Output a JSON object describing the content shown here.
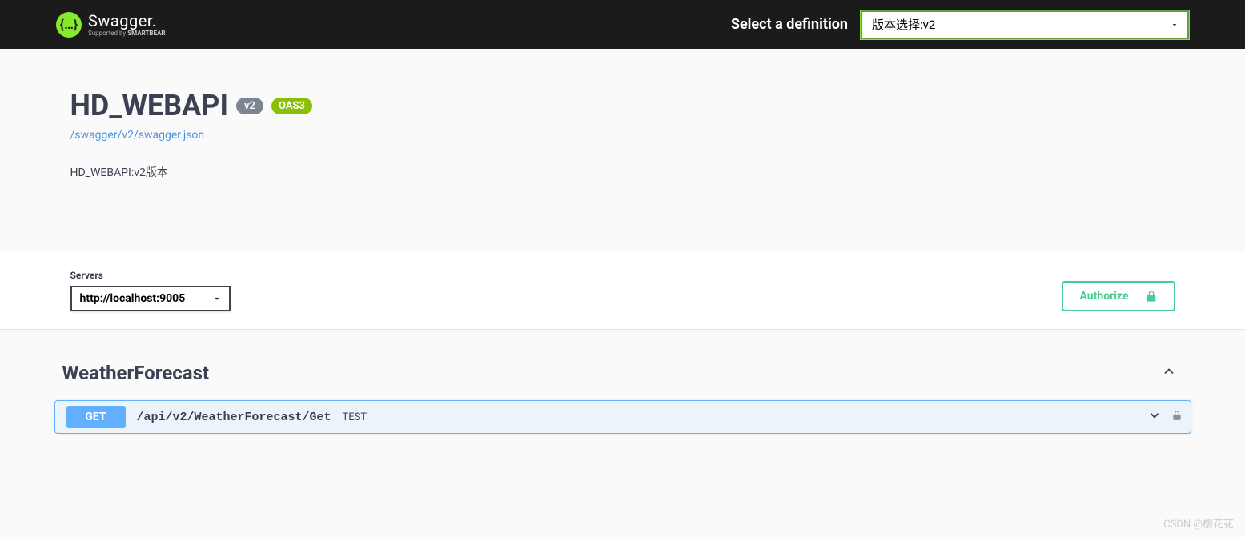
{
  "topbar": {
    "logo_main": "Swagger.",
    "logo_sub_prefix": "Supported by ",
    "logo_sub_brand": "SMARTBEAR",
    "select_label": "Select a definition",
    "definition_selected": "版本选择:v2"
  },
  "info": {
    "title": "HD_WEBAPI",
    "version_badge": "v2",
    "oas_badge": "OAS3",
    "spec_url": "/swagger/v2/swagger.json",
    "description": "HD_WEBAPI:v2版本"
  },
  "servers": {
    "label": "Servers",
    "selected": "http://localhost:9005"
  },
  "authorize": {
    "label": "Authorize"
  },
  "tags": [
    {
      "name": "WeatherForecast",
      "ops": [
        {
          "method": "GET",
          "path": "/api/v2/WeatherForecast/Get",
          "summary": "TEST"
        }
      ]
    }
  ],
  "watermark": "CSDN @樱花花"
}
